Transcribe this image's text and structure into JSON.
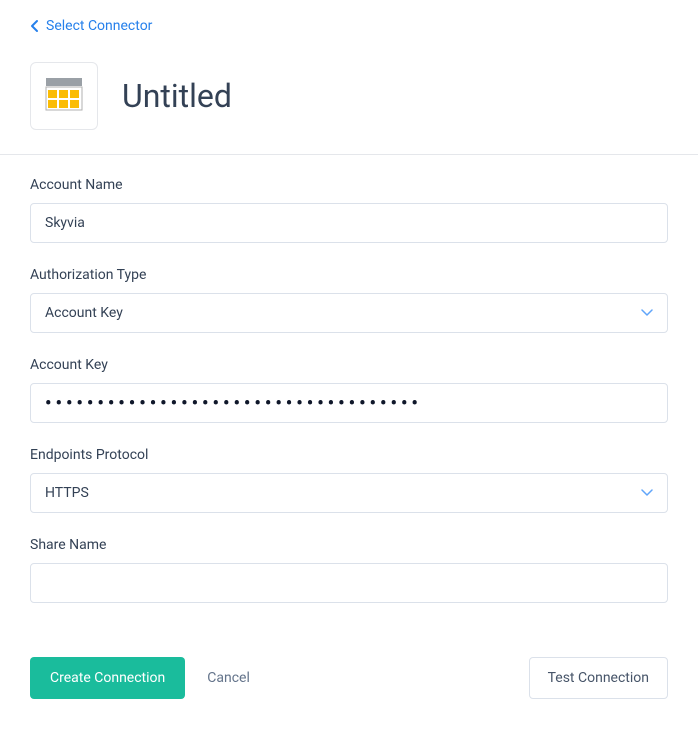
{
  "header": {
    "back_label": "Select Connector",
    "title": "Untitled"
  },
  "form": {
    "account_name": {
      "label": "Account Name",
      "value": "Skyvia"
    },
    "auth_type": {
      "label": "Authorization Type",
      "value": "Account Key"
    },
    "account_key": {
      "label": "Account Key",
      "value": "••••••••••••••••••••••••••••••••••••"
    },
    "endpoints_protocol": {
      "label": "Endpoints Protocol",
      "value": "HTTPS"
    },
    "share_name": {
      "label": "Share Name",
      "value": ""
    }
  },
  "actions": {
    "create": "Create Connection",
    "cancel": "Cancel",
    "test": "Test Connection"
  },
  "colors": {
    "link": "#2680eb",
    "primary": "#1abc9c",
    "border": "#dbe1ea"
  }
}
